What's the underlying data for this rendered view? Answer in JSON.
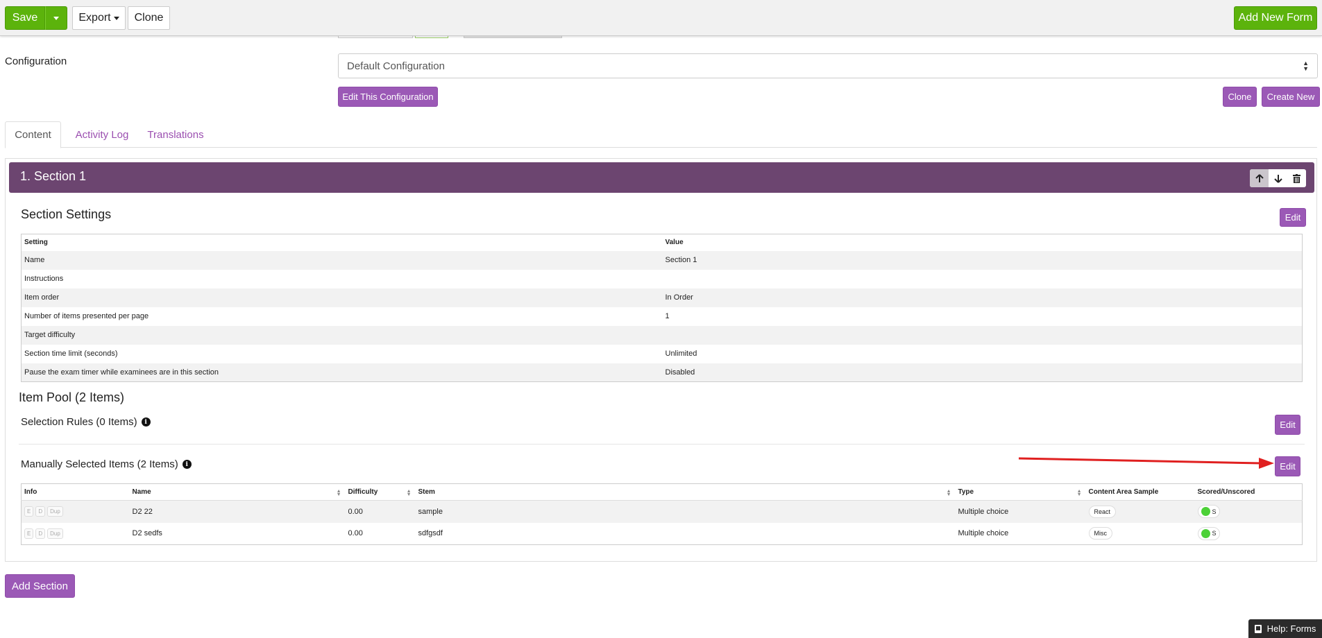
{
  "colors": {
    "green": "#5cb30c",
    "purple": "#9b59b6",
    "section_header": "#6c4570",
    "tab_link": "#9b4fb0",
    "annotation_arrow": "#e02020",
    "scored_dot": "#4cd137"
  },
  "toolbar": {
    "save_label": "Save",
    "export_label": "Export",
    "clone_label": "Clone",
    "add_new_form_label": "Add New Form"
  },
  "configuration": {
    "label": "Configuration",
    "selected": "Default Configuration",
    "edit_label": "Edit This Configuration",
    "clone_label": "Clone",
    "create_new_label": "Create New"
  },
  "tabs": [
    {
      "label": "Content",
      "active": true
    },
    {
      "label": "Activity Log",
      "active": false
    },
    {
      "label": "Translations",
      "active": false
    }
  ],
  "section": {
    "title": "1. Section 1",
    "settings_heading": "Section Settings",
    "edit_label": "Edit",
    "settings_columns": [
      "Setting",
      "Value"
    ],
    "settings_rows": [
      {
        "setting": "Name",
        "value": "Section 1"
      },
      {
        "setting": "Instructions",
        "value": ""
      },
      {
        "setting": "Item order",
        "value": "In Order"
      },
      {
        "setting": "Number of items presented per page",
        "value": "1"
      },
      {
        "setting": "Target difficulty",
        "value": ""
      },
      {
        "setting": "Section time limit (seconds)",
        "value": "Unlimited"
      },
      {
        "setting": "Pause the exam timer while examinees are in this section",
        "value": "Disabled"
      }
    ],
    "item_pool_heading": "Item Pool (2 Items)",
    "selection_rules_label": "Selection Rules (0 Items)",
    "manually_selected_label": "Manually Selected Items (2 Items)",
    "items_columns": [
      "Info",
      "Name",
      "Difficulty",
      "Stem",
      "Type",
      "Content Area Sample",
      "Scored/Unscored"
    ],
    "items": [
      {
        "info_buttons": [
          "E",
          "D",
          "Dup"
        ],
        "name": "D2 22",
        "difficulty": "0.00",
        "stem": "sample",
        "type": "Multiple choice",
        "content_area": "React",
        "scored": "S"
      },
      {
        "info_buttons": [
          "E",
          "D",
          "Dup"
        ],
        "name": "D2 sedfs",
        "difficulty": "0.00",
        "stem": "sdfgsdf",
        "type": "Multiple choice",
        "content_area": "Misc",
        "scored": "S"
      }
    ]
  },
  "add_section_label": "Add Section",
  "help_label": "Help: Forms",
  "icons": {
    "up": "arrow-up-icon",
    "down": "arrow-down-icon",
    "trash": "trash-icon",
    "info": "info-icon",
    "book": "book-icon"
  }
}
